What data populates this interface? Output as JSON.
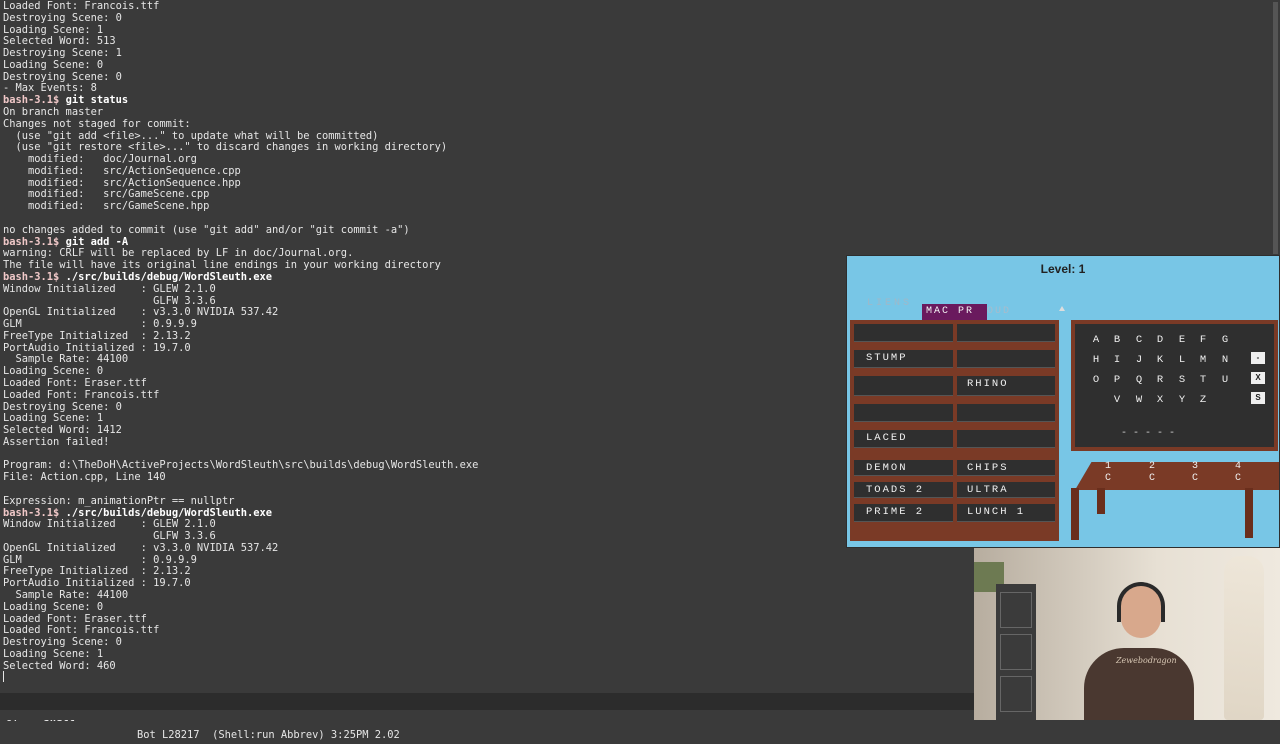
{
  "terminal": {
    "lines": [
      {
        "t": "Loaded Font: Francois.ttf",
        "c": "text"
      },
      {
        "t": "Destroying Scene: 0",
        "c": "text"
      },
      {
        "t": "Loading Scene: 1",
        "c": "text"
      },
      {
        "t": "Selected Word: 513",
        "c": "text"
      },
      {
        "t": "Destroying Scene: 1",
        "c": "text"
      },
      {
        "t": "Loading Scene: 0",
        "c": "text"
      },
      {
        "t": "Destroying Scene: 0",
        "c": "text"
      },
      {
        "t": "- Max Events: 8",
        "c": "text"
      },
      {
        "p": "bash-3.1$ ",
        "cmd": "git status"
      },
      {
        "t": "On branch master",
        "c": "text"
      },
      {
        "t": "Changes not staged for commit:",
        "c": "text"
      },
      {
        "t": "  (use \"git add <file>...\" to update what will be committed)",
        "c": "text"
      },
      {
        "t": "  (use \"git restore <file>...\" to discard changes in working directory)",
        "c": "text"
      },
      {
        "t": "    modified:   doc/Journal.org",
        "c": "text"
      },
      {
        "t": "    modified:   src/ActionSequence.cpp",
        "c": "text"
      },
      {
        "t": "    modified:   src/ActionSequence.hpp",
        "c": "text"
      },
      {
        "t": "    modified:   src/GameScene.cpp",
        "c": "text"
      },
      {
        "t": "    modified:   src/GameScene.hpp",
        "c": "text"
      },
      {
        "t": "",
        "c": "text"
      },
      {
        "t": "no changes added to commit (use \"git add\" and/or \"git commit -a\")",
        "c": "text"
      },
      {
        "p": "bash-3.1$ ",
        "cmd": "git add -A"
      },
      {
        "t": "warning: CRLF will be replaced by LF in doc/Journal.org.",
        "c": "warn"
      },
      {
        "t": "The file will have its original line endings in your working directory",
        "c": "text"
      },
      {
        "p": "bash-3.1$ ",
        "cmd": "./src/builds/debug/WordSleuth.exe"
      },
      {
        "t": "Window Initialized    : GLEW 2.1.0",
        "c": "text"
      },
      {
        "t": "                        GLFW 3.3.6",
        "c": "text"
      },
      {
        "t": "OpenGL Initialized    : v3.3.0 NVIDIA 537.42",
        "c": "text"
      },
      {
        "t": "GLM                   : 0.9.9.9",
        "c": "text"
      },
      {
        "t": "FreeType Initialized  : 2.13.2",
        "c": "text"
      },
      {
        "t": "PortAudio Initialized : 19.7.0",
        "c": "text"
      },
      {
        "t": "  Sample Rate: 44100",
        "c": "text"
      },
      {
        "t": "Loading Scene: 0",
        "c": "text"
      },
      {
        "t": "Loaded Font: Eraser.ttf",
        "c": "text"
      },
      {
        "t": "Loaded Font: Francois.ttf",
        "c": "text"
      },
      {
        "t": "Destroying Scene: 0",
        "c": "text"
      },
      {
        "t": "Loading Scene: 1",
        "c": "text"
      },
      {
        "t": "Selected Word: 1412",
        "c": "text"
      },
      {
        "t": "Assertion failed!",
        "c": "text"
      },
      {
        "t": "",
        "c": "text"
      },
      {
        "t": "Program: d:\\TheDoH\\ActiveProjects\\WordSleuth\\src\\builds\\debug\\WordSleuth.exe",
        "c": "warn"
      },
      {
        "t": "File: Action.cpp, Line 140",
        "c": "warn"
      },
      {
        "t": "",
        "c": "text"
      },
      {
        "t": "Expression: m_animationPtr == nullptr",
        "c": "warn"
      },
      {
        "p": "bash-3.1$ ",
        "cmd": "./src/builds/debug/WordSleuth.exe"
      },
      {
        "t": "Window Initialized    : GLEW 2.1.0",
        "c": "text"
      },
      {
        "t": "                        GLFW 3.3.6",
        "c": "text"
      },
      {
        "t": "OpenGL Initialized    : v3.3.0 NVIDIA 537.42",
        "c": "text"
      },
      {
        "t": "GLM                   : 0.9.9.9",
        "c": "text"
      },
      {
        "t": "FreeType Initialized  : 2.13.2",
        "c": "text"
      },
      {
        "t": "PortAudio Initialized : 19.7.0",
        "c": "text"
      },
      {
        "t": "  Sample Rate: 44100",
        "c": "text"
      },
      {
        "t": "Loading Scene: 0",
        "c": "text"
      },
      {
        "t": "Loaded Font: Eraser.ttf",
        "c": "text"
      },
      {
        "t": "Loaded Font: Francois.ttf",
        "c": "text"
      },
      {
        "t": "Destroying Scene: 0",
        "c": "text"
      },
      {
        "t": "Loading Scene: 1",
        "c": "text"
      },
      {
        "t": "Selected Word: 460",
        "c": "text"
      }
    ]
  },
  "modeline": {
    "left_prefix": "U:**-",
    "buffer": "*shell*",
    "right": "Bot L28217  (Shell:run Abbrev) 3:25PM 2.02"
  },
  "game": {
    "level": "Level: 1",
    "ghost_word": "LIENS",
    "selected_word": "MAC PR",
    "selected_ghost": "OUD",
    "board": {
      "left": [
        "",
        "STUMP",
        "",
        "",
        "LACED",
        "DEMON",
        "TOADS 2",
        "PRIME 2"
      ],
      "right": [
        "",
        "",
        "RHINO",
        "",
        "",
        "CHIPS",
        "ULTRA",
        "LUNCH 1"
      ]
    },
    "keyboard": {
      "rows": [
        [
          "A",
          "B",
          "C",
          "D",
          "E",
          "F",
          "G"
        ],
        [
          "H",
          "I",
          "J",
          "K",
          "L",
          "M",
          "N"
        ],
        [
          "O",
          "P",
          "Q",
          "R",
          "S",
          "T",
          "U"
        ],
        [
          "V",
          "W",
          "X",
          "Y",
          "Z"
        ]
      ],
      "controls": [
        "-",
        "X",
        "S"
      ],
      "slots": "- - - - -"
    },
    "desk": {
      "numbers": [
        "1",
        "2",
        "3",
        "4"
      ],
      "letters": [
        "C",
        "C",
        "C",
        "C"
      ]
    }
  },
  "webcam": {
    "shirt_text": "Zewebodragon"
  },
  "colors": {
    "terminal_bg": "#3a3a3a",
    "prompt": "#f0c8c8",
    "warning": "#e8888c",
    "game_bg": "#78c6e6",
    "board_frame": "#7a3a26",
    "board_cell": "#2f2f2f",
    "selected_word_bg": "#6a1a5e"
  }
}
